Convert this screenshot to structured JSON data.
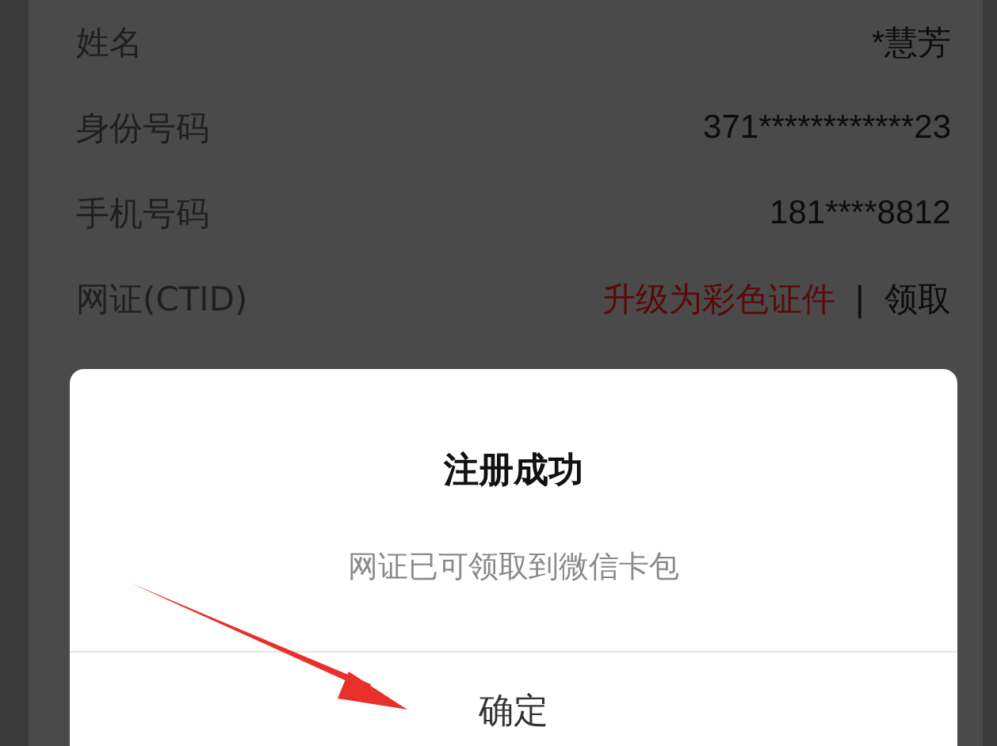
{
  "info_rows": [
    {
      "label": "姓名",
      "value": "*慧芳"
    },
    {
      "label": "身份号码",
      "value": "371************23"
    },
    {
      "label": "手机号码",
      "value": "181****8812"
    },
    {
      "label": "网证(CTID)",
      "links": [
        {
          "text": "升级为彩色证件",
          "kind": "highlight"
        },
        {
          "text": "领取",
          "kind": "plain"
        }
      ],
      "separator": "|"
    }
  ],
  "dialog": {
    "title": "注册成功",
    "message": "网证已可领取到微信卡包",
    "button": "确定"
  },
  "annotation": {
    "kind": "arrow"
  }
}
